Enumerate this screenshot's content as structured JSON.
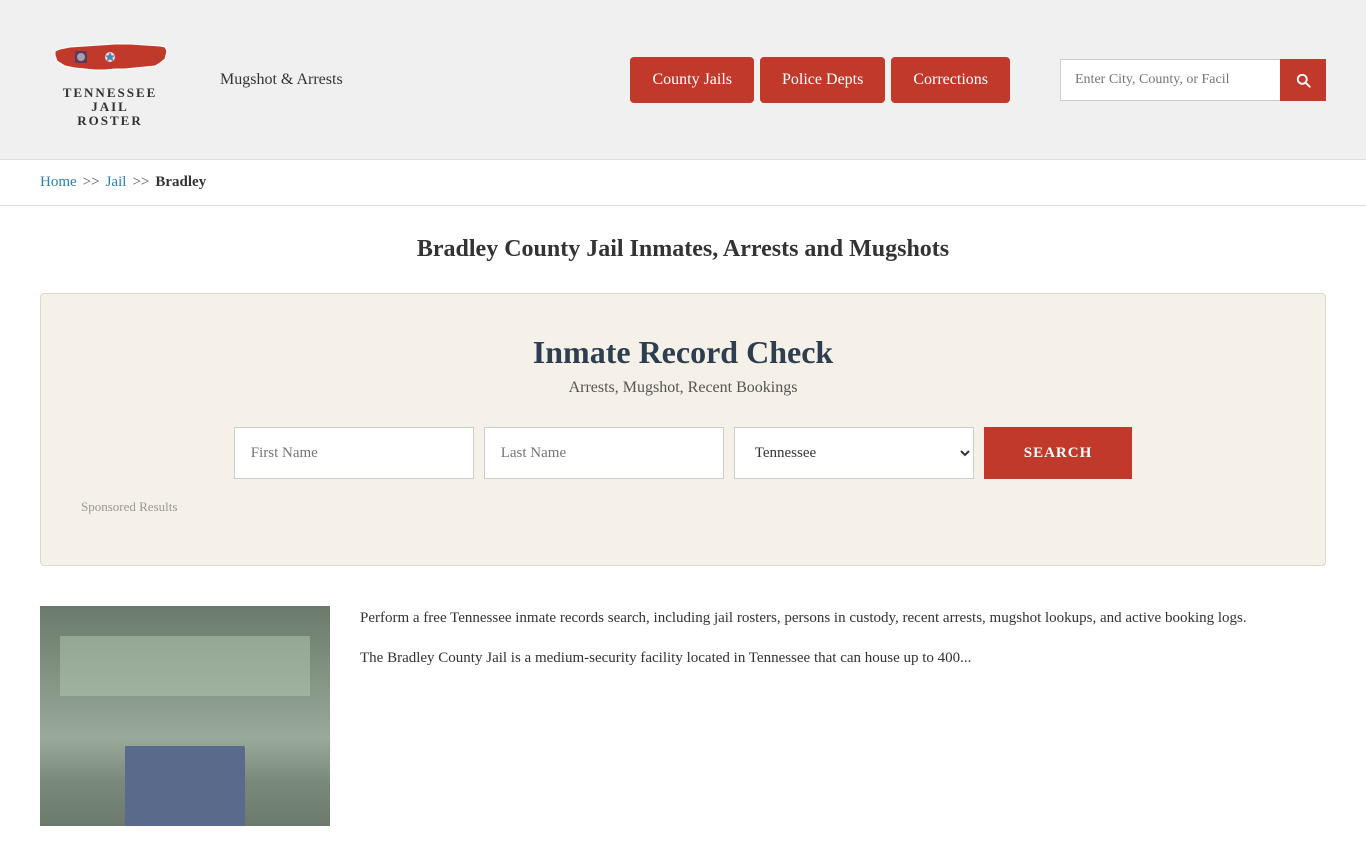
{
  "header": {
    "logo": {
      "line1": "TENNESSEE",
      "line2": "JAIL",
      "line3": "ROSTER"
    },
    "mugshot_link": "Mugshot & Arrests",
    "nav": {
      "county_jails": "County Jails",
      "police_depts": "Police Depts",
      "corrections": "Corrections"
    },
    "search_placeholder": "Enter City, County, or Facil"
  },
  "breadcrumb": {
    "home": "Home",
    "sep1": ">>",
    "jail": "Jail",
    "sep2": ">>",
    "current": "Bradley"
  },
  "page": {
    "title": "Bradley County Jail Inmates, Arrests and Mugshots"
  },
  "record_check": {
    "title": "Inmate Record Check",
    "subtitle": "Arrests, Mugshot, Recent Bookings",
    "first_name_placeholder": "First Name",
    "last_name_placeholder": "Last Name",
    "state_default": "Tennessee",
    "search_button": "SEARCH",
    "sponsored_label": "Sponsored Results"
  },
  "description": {
    "para1": "Perform a free Tennessee inmate records search, including jail rosters, persons in custody, recent arrests, mugshot lookups, and active booking logs.",
    "para2": "The Bradley County Jail is a medium-security facility located in Tennessee that can house up to 400..."
  }
}
